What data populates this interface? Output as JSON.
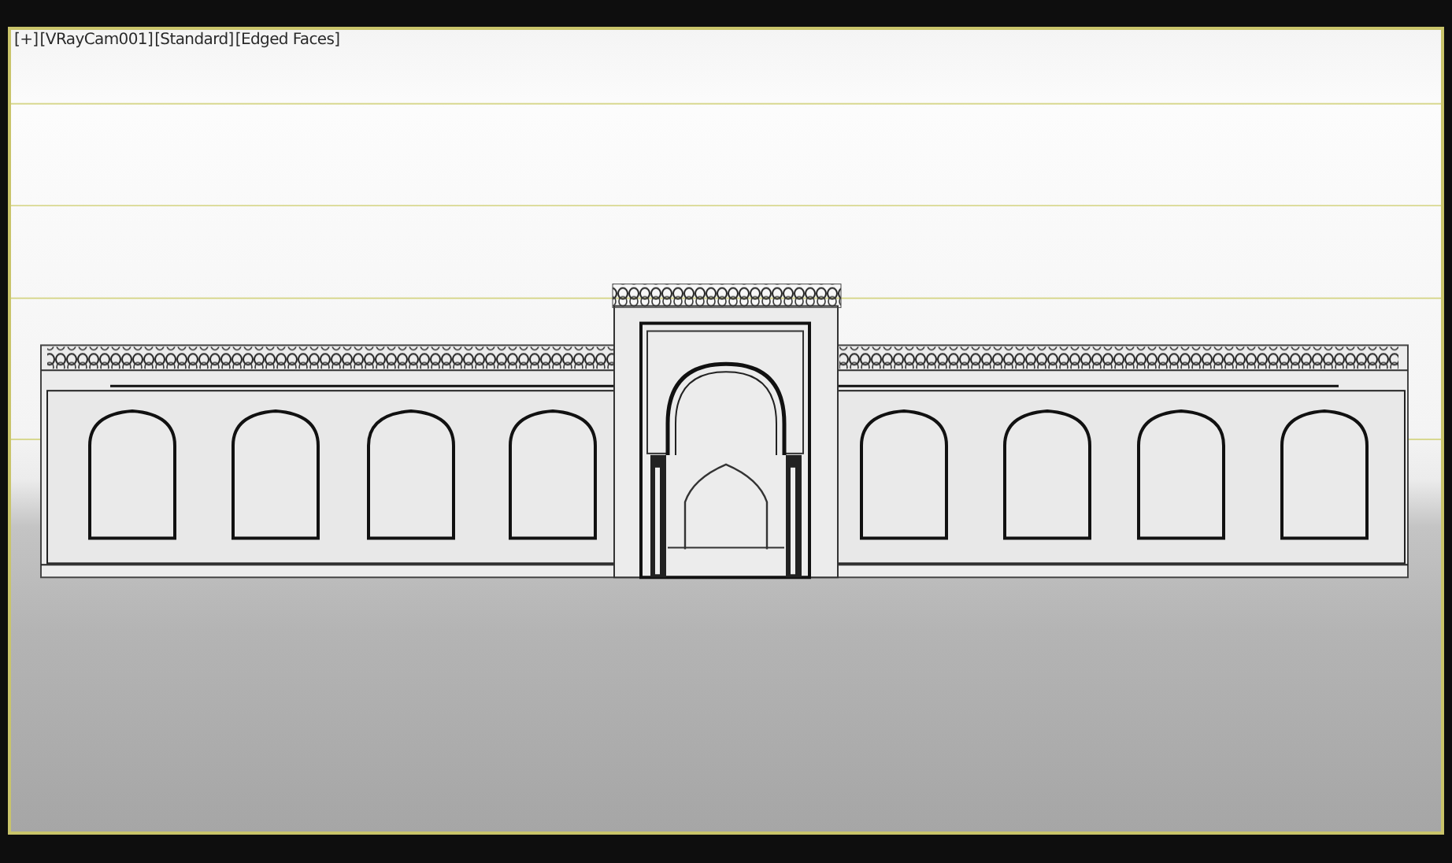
{
  "viewport": {
    "labels": [
      "[+]",
      "[VRayCam001]",
      "[Standard]",
      "[Edged Faces]"
    ],
    "active": true
  }
}
